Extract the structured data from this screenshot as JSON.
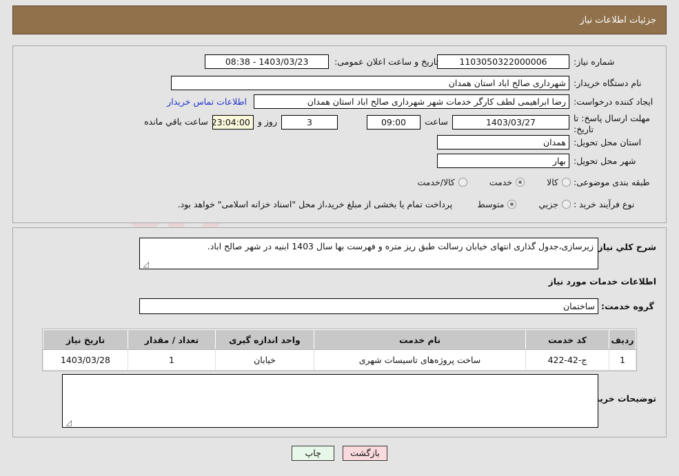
{
  "header": {
    "title": "جزئیات اطلاعات نیاز"
  },
  "form": {
    "need_number_label": "شماره نیاز:",
    "need_number_value": "1103050322000006",
    "announce_datetime_label": "تاریخ و ساعت اعلان عمومی:",
    "announce_datetime_value": "1403/03/23 - 08:38",
    "buyer_org_label": "نام دستگاه خریدار:",
    "buyer_org_value": "شهرداری صالح اباد استان همدان",
    "requester_label": "ایجاد کننده درخواست:",
    "requester_value": "رضا ابراهیمی لطف کارگر خدمات شهر شهرداری صالح اباد استان همدان",
    "contact_link": "اطلاعات تماس خریدار",
    "deadline_label": "مهلت ارسال پاسخ: تا تاریخ:",
    "deadline_date": "1403/03/27",
    "deadline_time_label": "ساعت",
    "deadline_time": "09:00",
    "remaining_days": "3",
    "remaining_days_label": "روز و",
    "remaining_time": "23:04:00",
    "remaining_time_label": "ساعت باقي مانده",
    "province_label": "استان محل تحویل:",
    "province_value": "همدان",
    "city_label": "شهر محل تحویل:",
    "city_value": "بهار",
    "category_label": "طبقه بندی موضوعی:",
    "category_options": [
      {
        "label": "کالا",
        "selected": false
      },
      {
        "label": "خدمت",
        "selected": true
      },
      {
        "label": "کالا/خدمت",
        "selected": false
      }
    ],
    "process_label": "نوع فرآیند خرید :",
    "process_options": [
      {
        "label": "جزیي",
        "selected": false
      },
      {
        "label": "متوسط",
        "selected": true
      }
    ],
    "payment_note": "پرداخت تمام یا بخشی از مبلغ خرید،از محل \"اسناد خزانه اسلامی\" خواهد بود."
  },
  "details": {
    "summary_label": "شرح کلي نیاز:",
    "summary_value": "زیرسازی،جدول گذاری انتهای خیابان رسالت طبق ریز متره و فهرست بها سال 1403 ابنیه در شهر صالح اباد.",
    "services_section_title": "اطلاعات خدمات مورد نیاز",
    "service_group_label": "گروه خدمت:",
    "service_group_value": "ساختمان",
    "buyer_notes_label": "توضیحات خریدار:",
    "buyer_notes_value": ""
  },
  "table": {
    "columns": [
      "ردیف",
      "کد خدمت",
      "نام خدمت",
      "واحد اندازه گیری",
      "تعداد / مقدار",
      "تاریخ نیاز"
    ],
    "rows": [
      [
        "1",
        "ج-42-422",
        "ساخت پروژه‌های تاسیسات شهری",
        "خیابان",
        "1",
        "1403/03/28"
      ]
    ]
  },
  "footer": {
    "print_button": "چاپ",
    "back_button": "بازگشت"
  },
  "watermark": {
    "text": "AriaTender.net"
  },
  "colors": {
    "header_bg": "#90714b",
    "page_bg": "#e4e4e4",
    "link": "#2233cc",
    "highlight_field": "#fbf8dc",
    "back_button_bg": "#fadadd",
    "print_button_bg": "#e8f8e8"
  }
}
